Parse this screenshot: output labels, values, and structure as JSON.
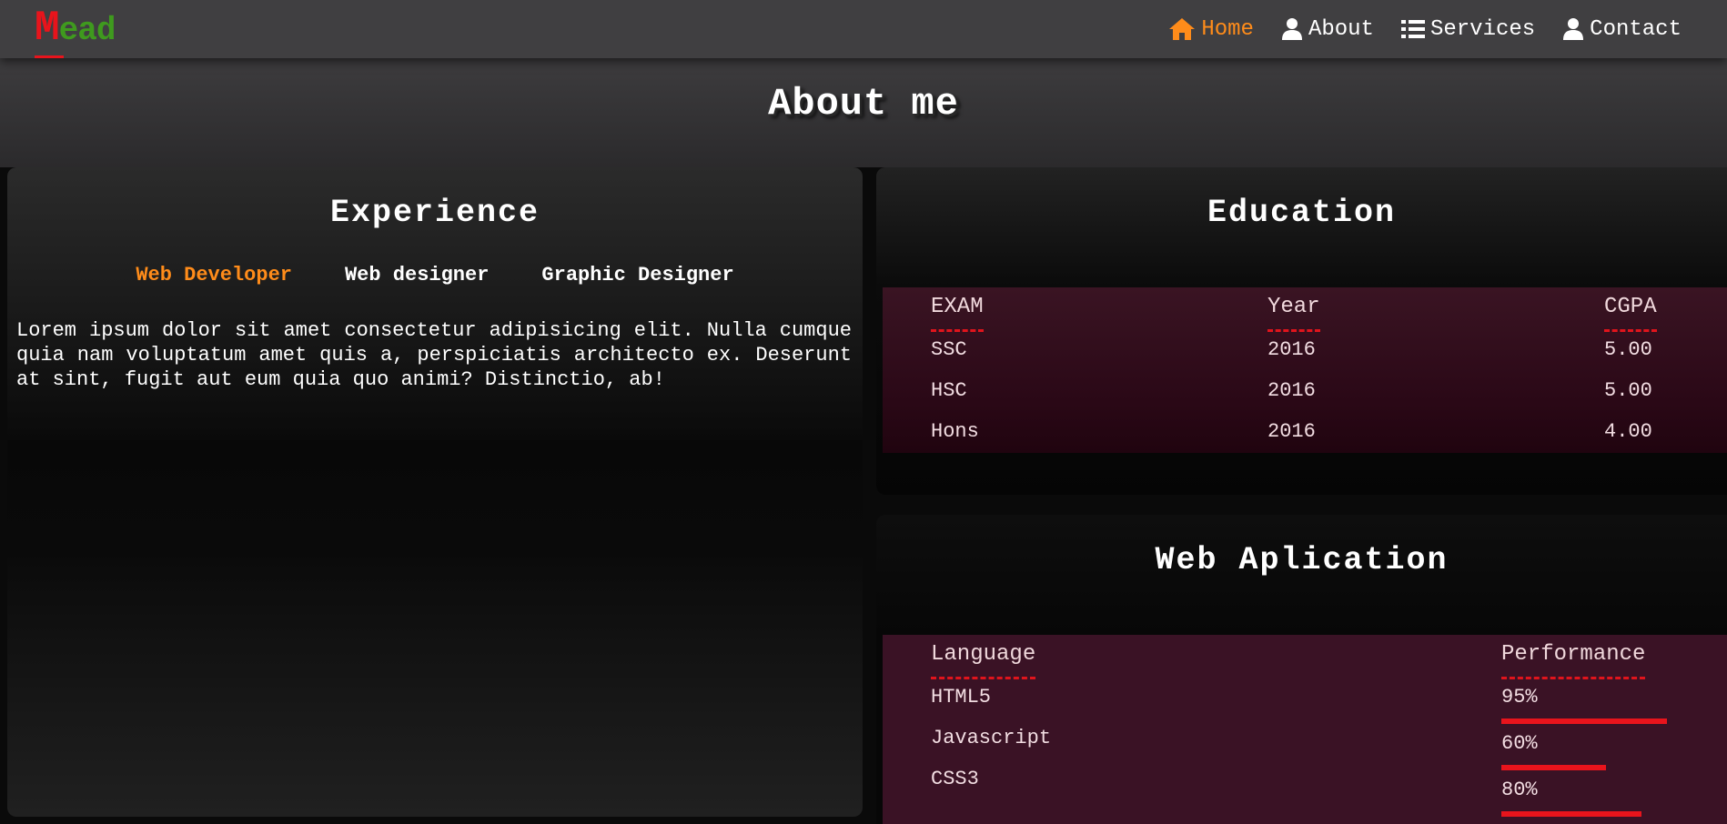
{
  "logo": {
    "first_letter": "M",
    "rest": "ead"
  },
  "nav": [
    {
      "label": "Home",
      "icon": "home-icon"
    },
    {
      "label": "About",
      "icon": "user-icon"
    },
    {
      "label": "Services",
      "icon": "list-icon"
    },
    {
      "label": "Contact",
      "icon": "user-icon"
    }
  ],
  "hero": {
    "title": "About me"
  },
  "experience": {
    "title": "Experience",
    "tabs": [
      "Web Developer",
      "Web designer",
      "Graphic Designer"
    ],
    "active_tab": "Web Developer",
    "text": "Lorem ipsum dolor sit amet consectetur adipisicing elit. Nulla cumque quia nam voluptatum amet quis a, perspiciatis architecto ex. Deserunt at sint, fugit aut eum quia quo animi? Distinctio, ab!"
  },
  "education": {
    "title": "Education",
    "headers": [
      "EXAM",
      "Year",
      "CGPA"
    ],
    "rows": [
      [
        "SSC",
        "2016",
        "5.00"
      ],
      [
        "HSC",
        "2016",
        "5.00"
      ],
      [
        "Hons",
        "2016",
        "4.00"
      ]
    ]
  },
  "web_application": {
    "title": "Web Aplication",
    "headers": [
      "Language",
      "Performance"
    ],
    "rows": [
      {
        "language": "HTML5",
        "performance_label": "95%",
        "performance": 95
      },
      {
        "language": "Javascript",
        "performance_label": "60%",
        "performance": 60
      },
      {
        "language": "CSS3",
        "performance_label": "80%",
        "performance": 80
      }
    ]
  },
  "colors": {
    "accent_orange": "#ff8c1a",
    "accent_red": "#e8141c",
    "logo_green": "#3f9a1e",
    "navbar_bg": "#403f41",
    "table_bg": "#3a1225"
  }
}
